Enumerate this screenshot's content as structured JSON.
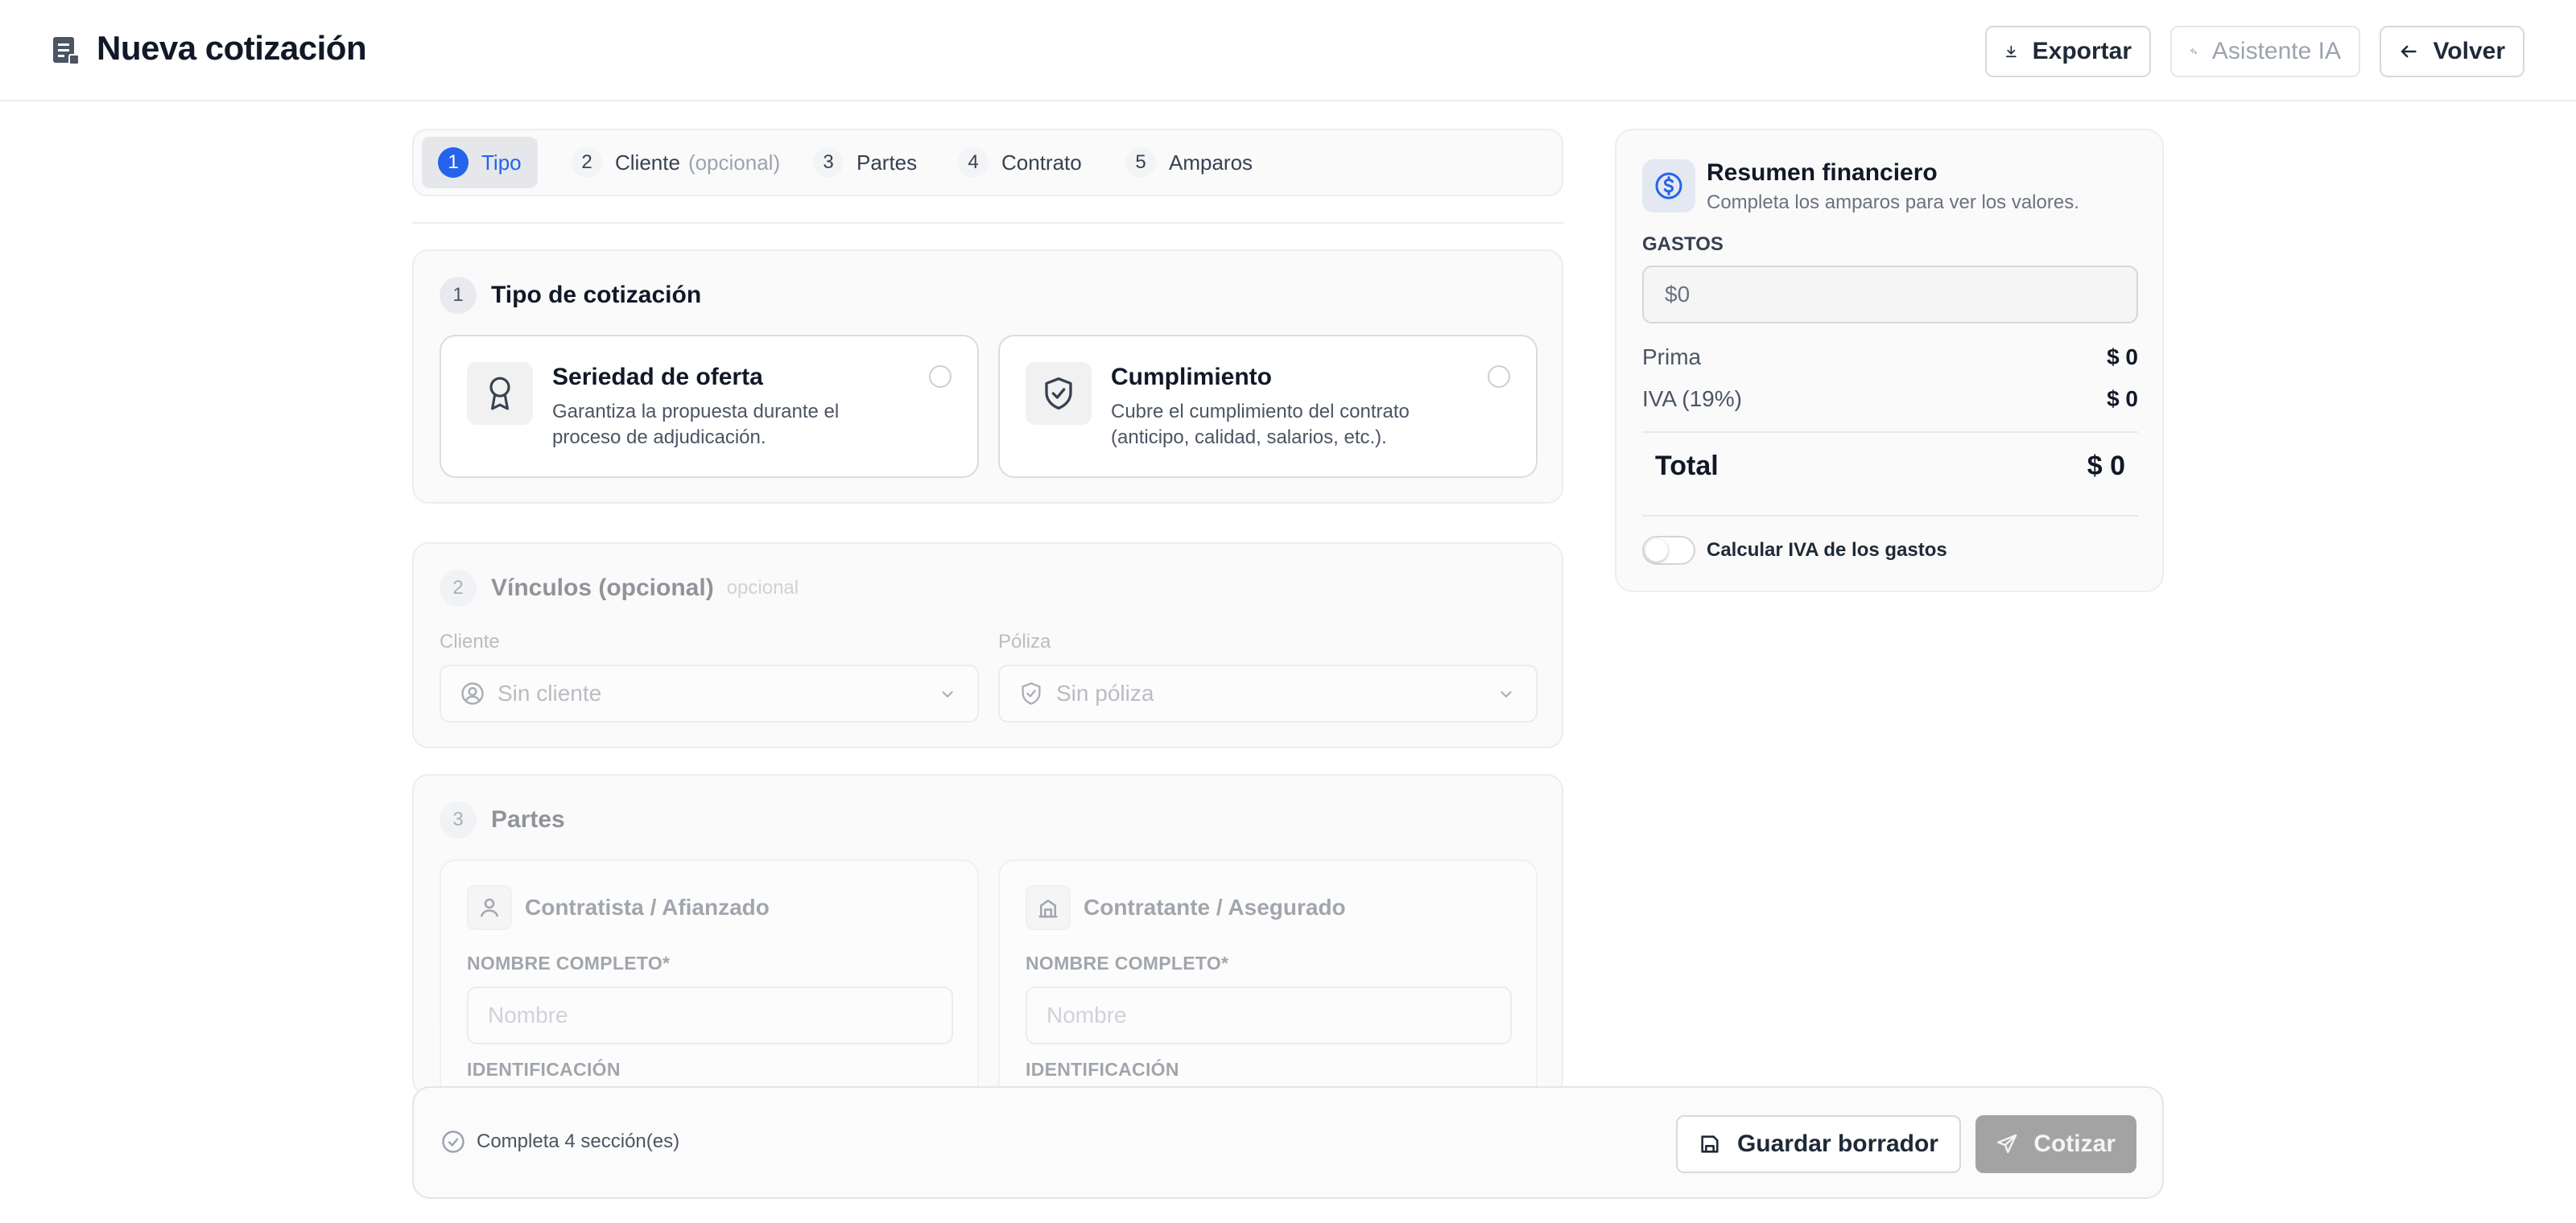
{
  "header": {
    "title": "Nueva cotización",
    "export_label": "Exportar",
    "ai_label": "Asistente IA",
    "back_label": "Volver"
  },
  "stepper": {
    "steps": [
      {
        "num": "1",
        "label": "Tipo",
        "optional": "",
        "active": true
      },
      {
        "num": "2",
        "label": "Cliente",
        "optional": "(opcional)",
        "active": false
      },
      {
        "num": "3",
        "label": "Partes",
        "optional": "",
        "active": false
      },
      {
        "num": "4",
        "label": "Contrato",
        "optional": "",
        "active": false
      },
      {
        "num": "5",
        "label": "Amparos",
        "optional": "",
        "active": false
      }
    ]
  },
  "section_type": {
    "num": "1",
    "title": "Tipo de cotización",
    "options": [
      {
        "title": "Seriedad de oferta",
        "description": "Garantiza la propuesta durante el proceso de adjudicación.",
        "icon": "award-icon",
        "selected": false
      },
      {
        "title": "Cumplimiento",
        "description": "Cubre el cumplimiento del contrato (anticipo, calidad, salarios, etc.).",
        "icon": "shield-check-icon",
        "selected": false
      }
    ]
  },
  "section_links": {
    "num": "2",
    "title": "Vínculos (opcional)",
    "optional": "opcional",
    "client_label": "Cliente",
    "client_value": "Sin cliente",
    "policy_label": "Póliza",
    "policy_value": "Sin póliza"
  },
  "section_parties": {
    "num": "3",
    "title": "Partes",
    "contractor": {
      "title": "Contratista / Afianzado",
      "name_label": "NOMBRE COMPLETO*",
      "name_placeholder": "Nombre",
      "id_label": "IDENTIFICACIÓN"
    },
    "contracting": {
      "title": "Contratante / Asegurado",
      "name_label": "NOMBRE COMPLETO*",
      "name_placeholder": "Nombre",
      "id_label": "IDENTIFICACIÓN"
    }
  },
  "summary": {
    "title": "Resumen financiero",
    "subtitle": "Completa los amparos para ver los valores.",
    "expenses_label": "GASTOS",
    "expenses_value": "$0",
    "premium_label": "Prima",
    "premium_value": "$ 0",
    "iva_label": "IVA (19%)",
    "iva_value": "$ 0",
    "total_label": "Total",
    "total_value": "$ 0",
    "toggle_label": "Calcular IVA de los gastos",
    "toggle_on": false
  },
  "footer": {
    "status": "Completa 4 sección(es)",
    "save_label": "Guardar borrador",
    "quote_label": "Cotizar"
  },
  "colors": {
    "accent": "#2563eb",
    "disabled_button": "#a3a3a3"
  }
}
